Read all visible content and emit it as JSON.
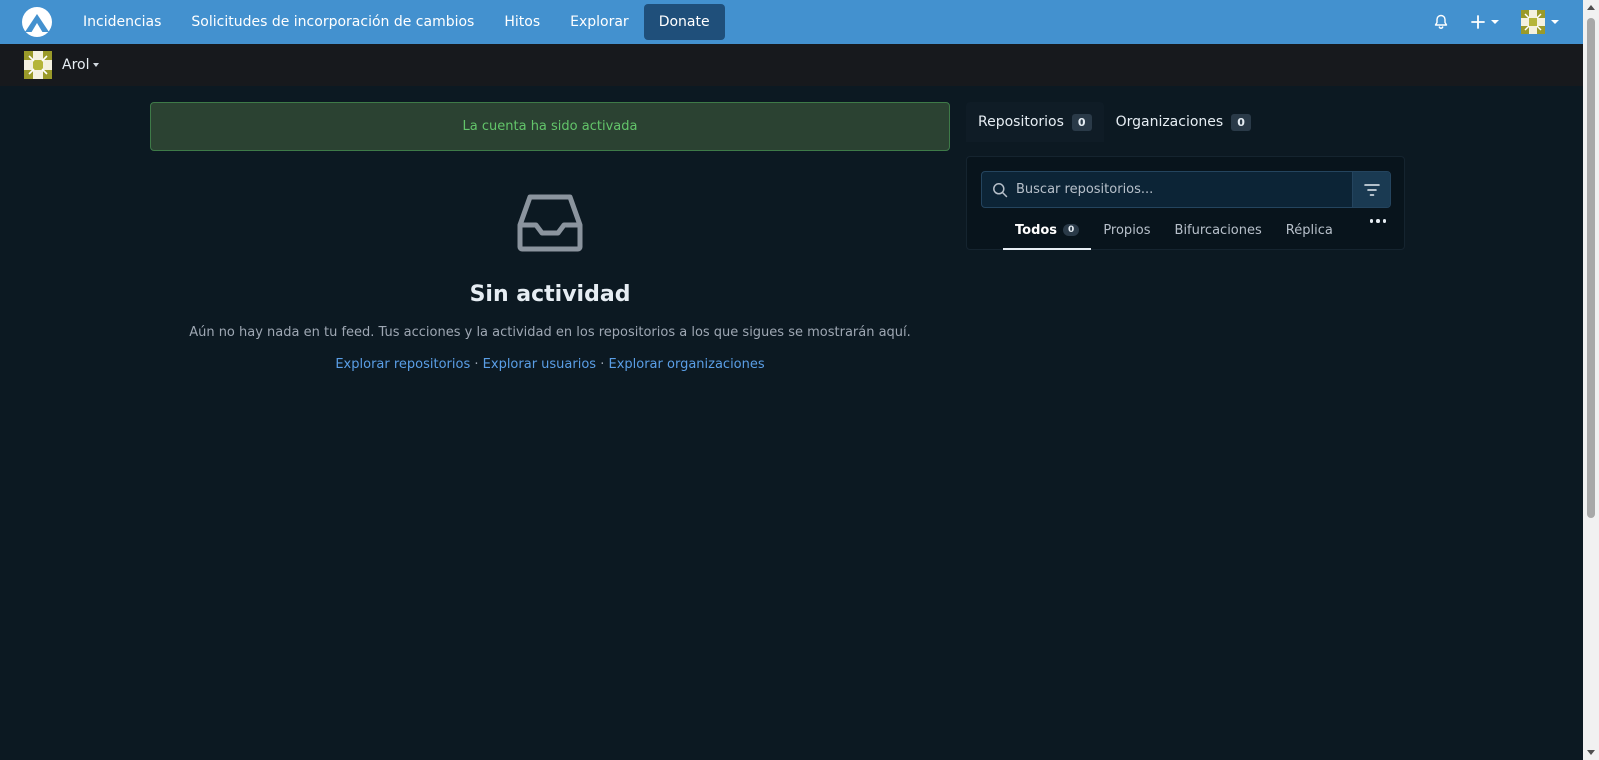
{
  "nav": {
    "items": [
      {
        "label": "Incidencias"
      },
      {
        "label": "Solicitudes de incorporación de cambios"
      },
      {
        "label": "Hitos"
      },
      {
        "label": "Explorar"
      },
      {
        "label": "Donate"
      }
    ],
    "active_index": 4,
    "icons": [
      "logo-icon",
      "bell-icon",
      "plus-icon",
      "avatar"
    ]
  },
  "context": {
    "user_name": "Arol"
  },
  "flash": {
    "message": "La cuenta ha sido activada"
  },
  "feed": {
    "icon": "inbox-icon",
    "title": "Sin actividad",
    "description": "Aún no hay nada en tu feed. Tus acciones y la actividad en los repositorios a los que sigues se mostrarán aquí.",
    "links": {
      "repos": "Explorar repositorios",
      "sep1": " · ",
      "users": "Explorar usuarios",
      "sep2": " · ",
      "orgs": "Explorar organizaciones"
    }
  },
  "sidebar": {
    "tabs": [
      {
        "label": "Repositorios",
        "count": "0"
      },
      {
        "label": "Organizaciones",
        "count": "0"
      }
    ],
    "search": {
      "placeholder": "Buscar repositorios..."
    },
    "filters": [
      {
        "label": "Todos",
        "count": "0"
      },
      {
        "label": "Propios"
      },
      {
        "label": "Bifurcaciones"
      },
      {
        "label": "Réplica"
      }
    ]
  },
  "colors": {
    "nav_bg": "#4391cf",
    "page_bg": "#0c1922",
    "subbar_bg": "#17191d",
    "flash_bg": "#2b4232",
    "flash_text": "#63c56a",
    "link": "#5a9ee6"
  }
}
